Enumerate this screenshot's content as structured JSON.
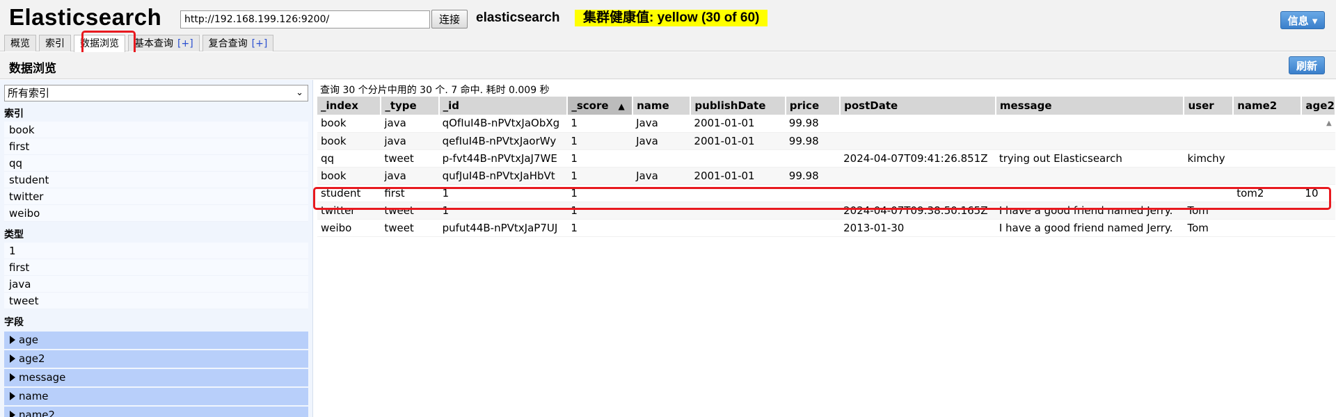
{
  "header": {
    "title": "Elasticsearch",
    "url": "http://192.168.199.126:9200/",
    "connect_label": "连接",
    "cluster_name": "elasticsearch",
    "health": "集群健康值: yellow (30 of 60)",
    "info_label": "信息 ▾",
    "tabs": [
      {
        "label": "概览"
      },
      {
        "label": "索引"
      },
      {
        "label": "数据浏览"
      },
      {
        "label": "基本查询",
        "plus": "[+]"
      },
      {
        "label": "复合查询",
        "plus": "[+]"
      }
    ]
  },
  "subheader": {
    "title": "数据浏览",
    "refresh_label": "刷新"
  },
  "sidebar": {
    "index_select": "所有索引",
    "index_heading": "索引",
    "indices": [
      "book",
      "first",
      "qq",
      "student",
      "twitter",
      "weibo"
    ],
    "type_heading": "类型",
    "types": [
      "1",
      "first",
      "java",
      "tweet"
    ],
    "field_heading": "字段",
    "fields": [
      "age",
      "age2",
      "message",
      "name",
      "name2"
    ]
  },
  "results": {
    "summary": "查询 30 个分片中用的 30 个. 7 命中. 耗时 0.009 秒",
    "columns": [
      "_index",
      "_type",
      "_id",
      "_score",
      "name",
      "publishDate",
      "price",
      "postDate",
      "message",
      "user",
      "name2",
      "age2"
    ],
    "sorted_column": "_score",
    "sort_arrow": "▲",
    "rows": [
      [
        "book",
        "java",
        "qOfIuI4B-nPVtxJaObXg",
        "1",
        "Java",
        "2001-01-01",
        "99.98",
        "",
        "",
        "",
        "",
        ""
      ],
      [
        "book",
        "java",
        "qefIuI4B-nPVtxJaorWy",
        "1",
        "Java",
        "2001-01-01",
        "99.98",
        "",
        "",
        "",
        "",
        ""
      ],
      [
        "qq",
        "tweet",
        "p-fvt44B-nPVtxJaJ7WE",
        "1",
        "",
        "",
        "",
        "2024-04-07T09:41:26.851Z",
        "trying out Elasticsearch",
        "kimchy",
        "",
        ""
      ],
      [
        "book",
        "java",
        "qufJuI4B-nPVtxJaHbVt",
        "1",
        "Java",
        "2001-01-01",
        "99.98",
        "",
        "",
        "",
        "",
        ""
      ],
      [
        "student",
        "first",
        "1",
        "1",
        "",
        "",
        "",
        "",
        "",
        "",
        "tom2",
        "10"
      ],
      [
        "twitter",
        "tweet",
        "1",
        "1",
        "",
        "",
        "",
        "2024-04-07T09:38:50.165Z",
        "I have a good friend named Jerry.",
        "Tom",
        "",
        ""
      ],
      [
        "weibo",
        "tweet",
        "pufut44B-nPVtxJaP7UJ",
        "1",
        "",
        "",
        "",
        "2013-01-30",
        "I have a good friend named Jerry.",
        "Tom",
        "",
        ""
      ]
    ]
  },
  "colors": {
    "health_bg": "#ffff00",
    "highlight_border": "#e8191f",
    "field_bg": "#b8cffa",
    "button_blue": "#3a7fcb"
  }
}
